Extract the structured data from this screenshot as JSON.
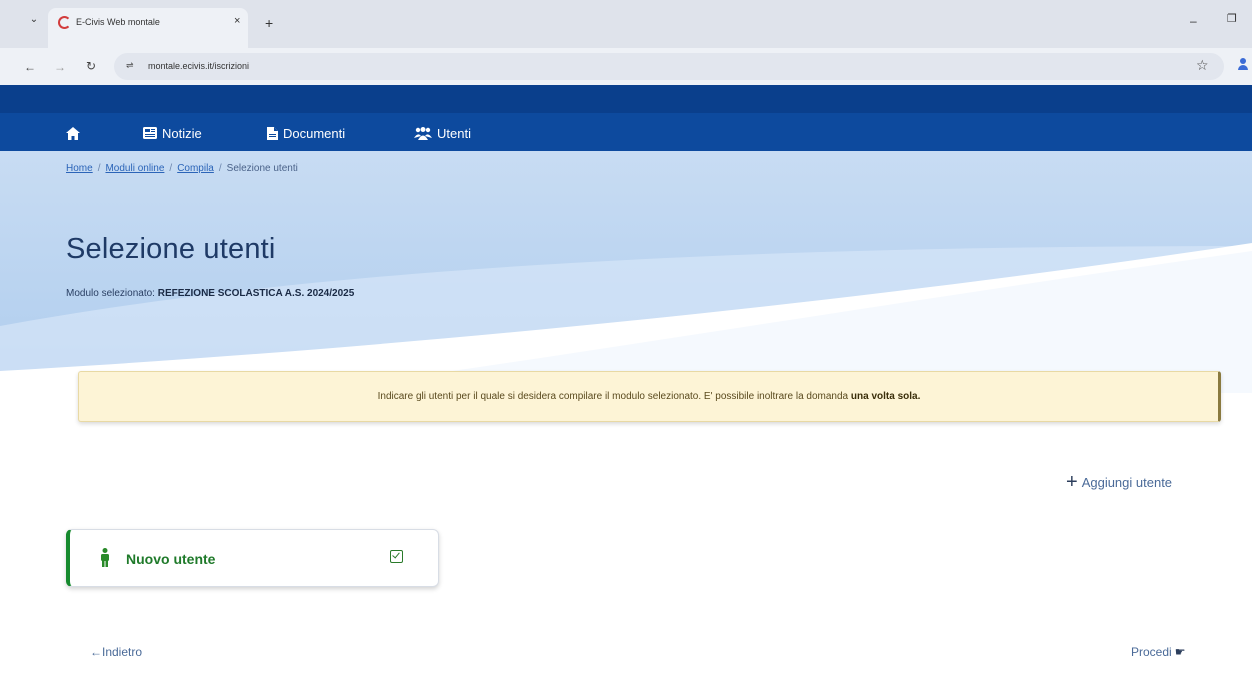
{
  "browser": {
    "tab_title": "E-Civis Web montale",
    "tab_close": "×",
    "new_tab": "+",
    "url": "montale.ecivis.it/iscrizioni",
    "icons": [
      "chevron-down-icon",
      "site-favicon-icon",
      "back-icon",
      "forward-icon",
      "reload-icon",
      "site-info-icon",
      "star-icon",
      "profile-icon",
      "minimize-icon",
      "restore-icon"
    ]
  },
  "nav": {
    "home_icon": "⌂",
    "items": [
      {
        "label": "Notizie",
        "icon": "newspaper-icon"
      },
      {
        "label": "Documenti",
        "icon": "document-icon"
      },
      {
        "label": "Utenti",
        "icon": "users-icon"
      }
    ]
  },
  "breadcrumb": {
    "items": [
      "Home",
      "Moduli online",
      "Compila"
    ],
    "separator": "/",
    "current": "Selezione utenti"
  },
  "page": {
    "title": "Selezione utenti",
    "module_label": "Modulo selezionato:",
    "module_name": "REFEZIONE SCOLASTICA A.S. 2024/2025"
  },
  "alert": {
    "text": "Indicare gli utenti per il quale si desidera compilare il modulo selezionato.  E' possibile inoltrare la domanda",
    "emphasis": "una volta sola."
  },
  "actions": {
    "add_user_label": "Aggiungi utente",
    "back_label": "Indietro",
    "proceed_label": "Procedi"
  },
  "users": [
    {
      "name": "Nuovo utente",
      "selected": true
    }
  ],
  "colors": {
    "nav_bg": "#0d4a9e",
    "header_top_bg": "#0a3f8c",
    "hero_bg": "#b9d3f0",
    "alert_bg": "#fdf4d6",
    "user_accent": "#168a2e"
  }
}
